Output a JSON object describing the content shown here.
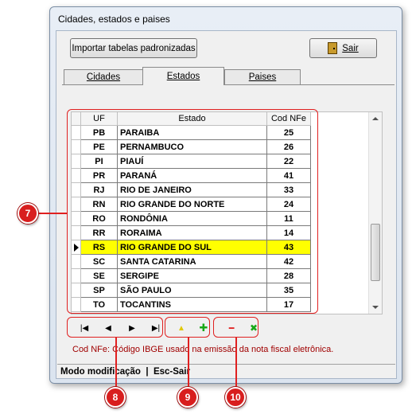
{
  "window": {
    "title": "Cidades, estados e paises"
  },
  "toolbar": {
    "import_label": "Importar tabelas padronizadas",
    "exit_label": "Sair"
  },
  "tabs": [
    {
      "label": "Cidades"
    },
    {
      "label": "Estados"
    },
    {
      "label": "Paises"
    }
  ],
  "grid": {
    "headers": [
      "UF",
      "Estado",
      "Cod NFe"
    ],
    "rows": [
      {
        "uf": "PB",
        "estado": "PARAIBA",
        "cod": "25"
      },
      {
        "uf": "PE",
        "estado": "PERNAMBUCO",
        "cod": "26"
      },
      {
        "uf": "PI",
        "estado": "PIAUÍ",
        "cod": "22"
      },
      {
        "uf": "PR",
        "estado": "PARANÁ",
        "cod": "41"
      },
      {
        "uf": "RJ",
        "estado": "RIO DE JANEIRO",
        "cod": "33"
      },
      {
        "uf": "RN",
        "estado": "RIO GRANDE DO NORTE",
        "cod": "24"
      },
      {
        "uf": "RO",
        "estado": "RONDÔNIA",
        "cod": "11"
      },
      {
        "uf": "RR",
        "estado": "RORAIMA",
        "cod": "14"
      },
      {
        "uf": "RS",
        "estado": "RIO GRANDE DO SUL",
        "cod": "43"
      },
      {
        "uf": "SC",
        "estado": "SANTA CATARINA",
        "cod": "42"
      },
      {
        "uf": "SE",
        "estado": "SERGIPE",
        "cod": "28"
      },
      {
        "uf": "SP",
        "estado": "SÃO PAULO",
        "cod": "35"
      },
      {
        "uf": "TO",
        "estado": "TOCANTINS",
        "cod": "17"
      }
    ],
    "selected_uf": "RS"
  },
  "nav": {
    "first": "|◀",
    "prev": "◀",
    "next": "▶",
    "last": "▶|",
    "edit_icon": "▲",
    "add_icon": "✚",
    "delete_icon": "━",
    "cancel_icon": "✖"
  },
  "info_text": "Cod NFe: Código IBGE usado na emissão da nota fiscal eletrônica.",
  "status": {
    "text": "Modo modificação  |  Esc-Sair"
  },
  "callouts": {
    "grid": "7",
    "navigation": "8",
    "edit_add": "9",
    "delete_cancel": "10"
  },
  "colors": {
    "highlight": "#ffff00",
    "callout": "#e02020",
    "info": "#a00000"
  }
}
